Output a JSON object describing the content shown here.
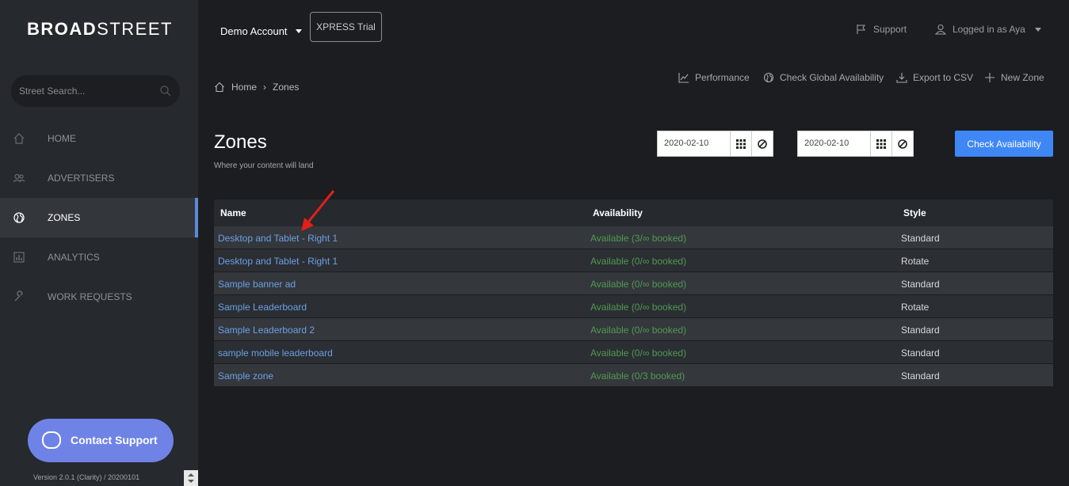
{
  "brand": {
    "logo_bold": "BROAD",
    "logo_light": "STREET"
  },
  "search": {
    "placeholder": "Street Search..."
  },
  "sidebar": {
    "items": [
      {
        "label": "HOME",
        "icon": "home-icon"
      },
      {
        "label": "ADVERTISERS",
        "icon": "users-icon"
      },
      {
        "label": "ZONES",
        "icon": "globe-icon",
        "active": true
      },
      {
        "label": "ANALYTICS",
        "icon": "bar-chart-icon"
      },
      {
        "label": "WORK REQUESTS",
        "icon": "wrench-icon"
      }
    ],
    "contact_label": "Contact Support",
    "version": "Version 2.0.1 (Clarity) / 20200101"
  },
  "topbar": {
    "account": "Demo Account",
    "trial": "XPRESS Trial",
    "support": "Support",
    "user": "Logged in as Aya"
  },
  "breadcrumb": {
    "home": "Home",
    "current": "Zones"
  },
  "actions": {
    "performance": "Performance",
    "global": "Check Global Availability",
    "export": "Export to CSV",
    "new_zone": "New Zone"
  },
  "page": {
    "title": "Zones",
    "subtitle": "Where your content will land"
  },
  "dates": {
    "start": "2020-02-10",
    "end": "2020-02-10"
  },
  "check_label": "Check Availability",
  "table": {
    "headers": {
      "name": "Name",
      "availability": "Availability",
      "style": "Style"
    },
    "rows": [
      {
        "name": "Desktop and Tablet - Right 1",
        "availability": "Available (3/∞ booked)",
        "style": "Standard"
      },
      {
        "name": "Desktop and Tablet - Right 1",
        "availability": "Available (0/∞ booked)",
        "style": "Rotate"
      },
      {
        "name": "Sample banner ad",
        "availability": "Available (0/∞ booked)",
        "style": "Standard"
      },
      {
        "name": "Sample Leaderboard",
        "availability": "Available (0/∞ booked)",
        "style": "Rotate"
      },
      {
        "name": "Sample Leaderboard 2",
        "availability": "Available (0/∞ booked)",
        "style": "Standard"
      },
      {
        "name": "sample mobile leaderboard",
        "availability": "Available (0/∞ booked)",
        "style": "Standard"
      },
      {
        "name": "Sample zone",
        "availability": "Available (0/3 booked)",
        "style": "Standard"
      }
    ]
  },
  "colors": {
    "accent": "#3f87f5",
    "link": "#6ba0e6",
    "available": "#4f9a52",
    "contact": "#6f83e6",
    "arrow": "#e0201a"
  }
}
